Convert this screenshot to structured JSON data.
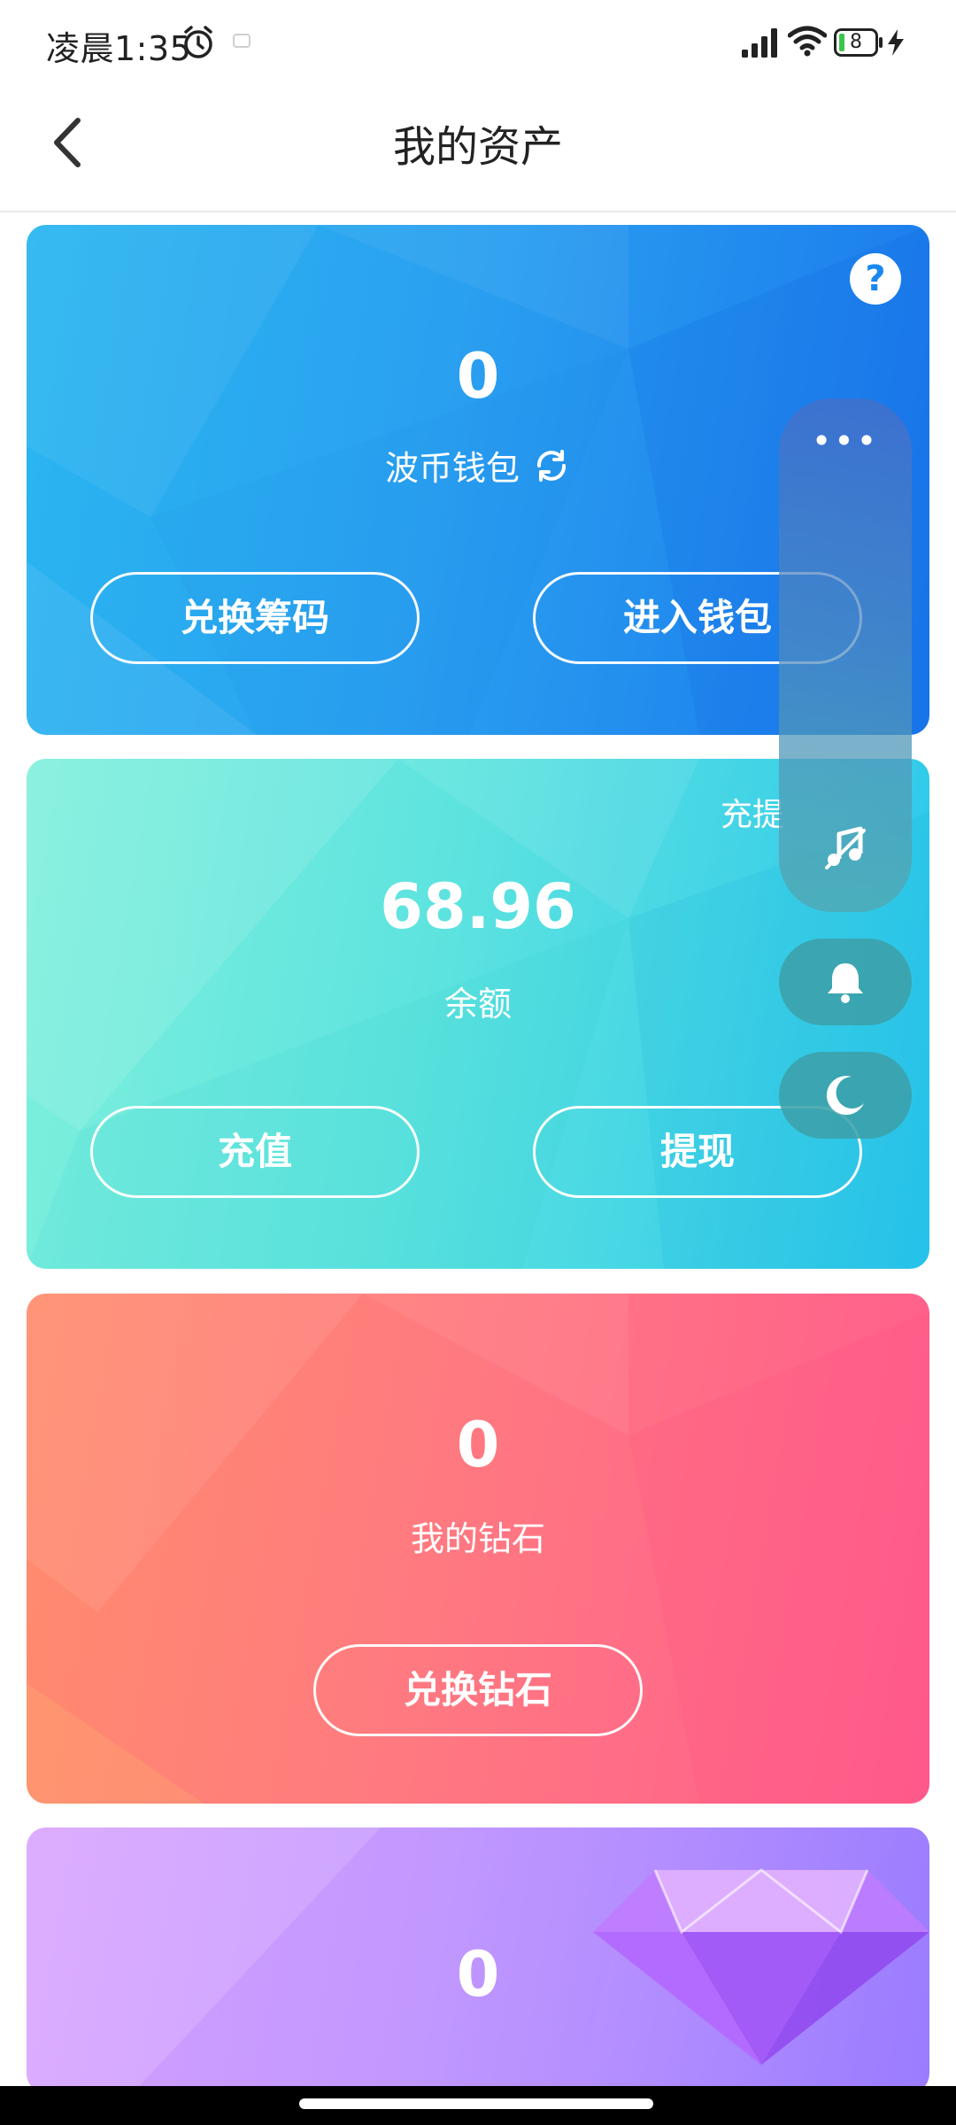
{
  "status_bar": {
    "time": "凌晨1:35",
    "battery": "8",
    "icons": [
      "alarm-icon",
      "message-icon",
      "signal-icon",
      "wifi-icon",
      "battery-icon",
      "charging-icon"
    ]
  },
  "header": {
    "title": "我的资产",
    "back_icon": "chevron-left-icon"
  },
  "cards": {
    "wallet": {
      "value": "0",
      "label": "波币钱包",
      "refresh_icon": "refresh-icon",
      "help": "?",
      "buttons": {
        "exchange": "兑换筹码",
        "enter": "进入钱包"
      }
    },
    "balance": {
      "value": "68.96",
      "label": "余额",
      "top_link": "充提",
      "buttons": {
        "recharge": "充值",
        "withdraw": "提现"
      }
    },
    "diamonds": {
      "value": "0",
      "label": "我的钻石",
      "buttons": {
        "exchange": "兑换钻石"
      }
    },
    "fourth": {
      "value": "0",
      "decor_icon": "gem-icon"
    }
  },
  "floating_panel": {
    "more": "•••",
    "icons": [
      "music-off-icon",
      "bell-icon",
      "moon-icon"
    ]
  },
  "colors": {
    "wallet_card": [
      "#2ab6f0",
      "#1a78ec"
    ],
    "balance_card": [
      "#7ff0dc",
      "#2ac6ec"
    ],
    "diamond_card": [
      "#ff8c6c",
      "#ff5c8e"
    ],
    "fourth_card": [
      "#d9a4ff",
      "#9a7cff"
    ]
  }
}
